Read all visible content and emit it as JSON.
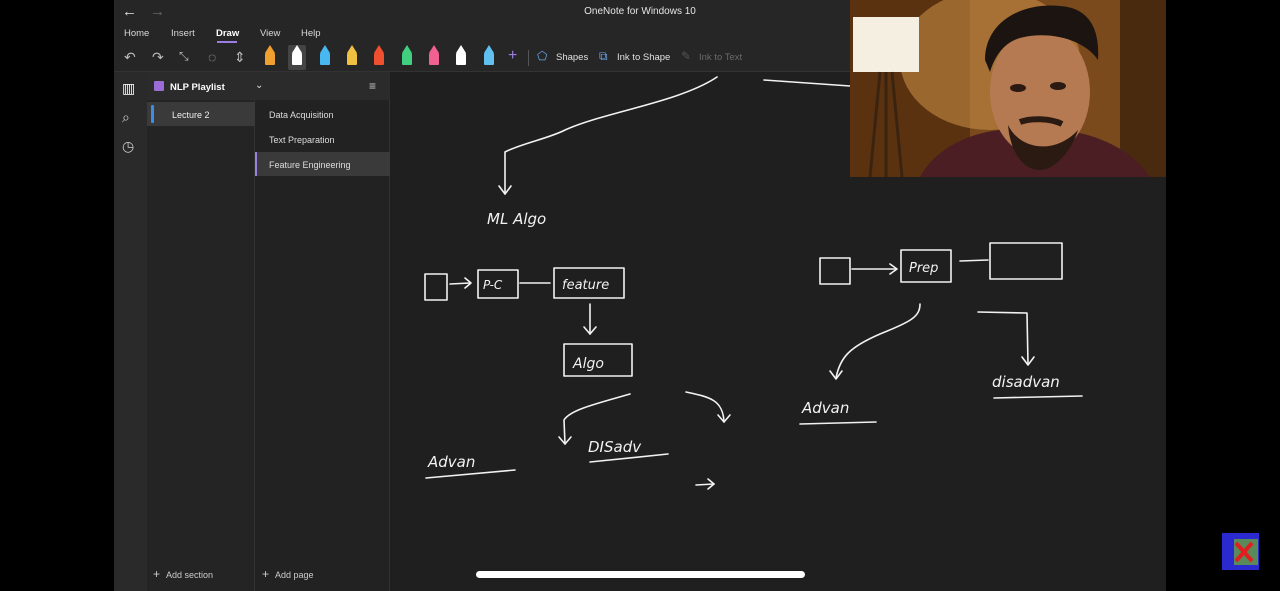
{
  "window": {
    "title": "OneNote for Windows 10",
    "back_icon": "arrow-left",
    "forward_icon": "arrow-right"
  },
  "menu": {
    "tabs": [
      "Home",
      "Insert",
      "Draw",
      "View",
      "Help"
    ],
    "active_tab": "Draw"
  },
  "ribbon": {
    "undo_icon": "undo",
    "redo_icon": "redo",
    "pens": [
      {
        "color": "#f0a030",
        "name": "highlighter-orange"
      },
      {
        "color": "#ffffff",
        "name": "pen-white",
        "selected": true
      },
      {
        "color": "#4ab8f0",
        "name": "pen-blue"
      },
      {
        "color": "#f0c040",
        "name": "pen-yellow"
      },
      {
        "color": "#f05030",
        "name": "highlighter-red"
      },
      {
        "color": "#40d080",
        "name": "pen-green"
      },
      {
        "color": "#f06090",
        "name": "pen-pink"
      },
      {
        "color": "#ffffff",
        "name": "pen-white-2"
      },
      {
        "color": "#60c0f0",
        "name": "pen-cyan"
      }
    ],
    "add_pen_label": "+",
    "shapes_label": "Shapes",
    "ink_to_shape_label": "Ink to Shape",
    "ink_to_text_label": "Ink to Text"
  },
  "notebook": {
    "name": "NLP Playlist",
    "sections": [
      "Lecture 2"
    ],
    "pages": [
      "Data Acquisition",
      "Text Preparation",
      "Feature Engineering"
    ],
    "selected_page": "Feature Engineering",
    "add_section_label": "Add section",
    "add_page_label": "Add page"
  },
  "canvas": {
    "ink_labels": {
      "ml_algo": "ML Algo",
      "prep_1": "P-C",
      "feature": "feature",
      "algo": "Algo",
      "advan_1": "Advan",
      "disadv_1": "DISadv",
      "prep_2": "Prep",
      "advan_2": "Advan",
      "disadvan_2": "disadvan"
    }
  }
}
